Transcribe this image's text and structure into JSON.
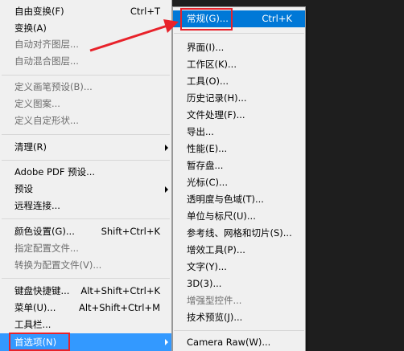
{
  "main_menu": {
    "items": [
      {
        "label": "自由变换(F)",
        "shortcut": "Ctrl+T"
      },
      {
        "label": "变换(A)"
      },
      {
        "label": "自动对齐图层..."
      },
      {
        "label": "自动混合图层..."
      },
      {
        "label": "定义画笔预设(B)..."
      },
      {
        "label": "定义图案..."
      },
      {
        "label": "定义自定形状..."
      },
      {
        "label": "清理(R)"
      },
      {
        "label": "Adobe PDF 预设..."
      },
      {
        "label": "预设"
      },
      {
        "label": "远程连接..."
      },
      {
        "label": "颜色设置(G)...",
        "shortcut": "Shift+Ctrl+K"
      },
      {
        "label": "指定配置文件..."
      },
      {
        "label": "转换为配置文件(V)..."
      },
      {
        "label": "键盘快捷键...",
        "shortcut": "Alt+Shift+Ctrl+K"
      },
      {
        "label": "菜单(U)...",
        "shortcut": "Alt+Shift+Ctrl+M"
      },
      {
        "label": "工具栏..."
      },
      {
        "label": "首选项(N)"
      }
    ]
  },
  "sub_menu": {
    "items": [
      {
        "label": "常规(G)...",
        "shortcut": "Ctrl+K"
      },
      {
        "label": "界面(I)..."
      },
      {
        "label": "工作区(K)..."
      },
      {
        "label": "工具(O)..."
      },
      {
        "label": "历史记录(H)..."
      },
      {
        "label": "文件处理(F)..."
      },
      {
        "label": "导出..."
      },
      {
        "label": "性能(E)..."
      },
      {
        "label": "暂存盘..."
      },
      {
        "label": "光标(C)..."
      },
      {
        "label": "透明度与色域(T)..."
      },
      {
        "label": "单位与标尺(U)..."
      },
      {
        "label": "参考线、网格和切片(S)..."
      },
      {
        "label": "增效工具(P)..."
      },
      {
        "label": "文字(Y)..."
      },
      {
        "label": "3D(3)..."
      },
      {
        "label": "增强型控件..."
      },
      {
        "label": "技术预览(J)..."
      },
      {
        "label": "Camera Raw(W)..."
      }
    ]
  },
  "colors": {
    "highlight": "#3399ff",
    "annotation": "#e8222a",
    "background": "#1e1e1e"
  }
}
